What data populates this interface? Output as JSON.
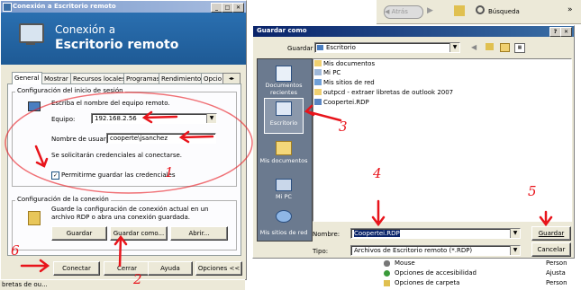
{
  "rdc": {
    "title": "Conexión a Escritorio remoto",
    "banner_line1": "Conexión a",
    "banner_line2": "Escritorio remoto",
    "tabs": [
      "General",
      "Mostrar",
      "Recursos locales",
      "Programas",
      "Rendimiento",
      "Opcio"
    ],
    "group_login": "Configuración del inicio de sesión",
    "prompt": "Escriba el nombre del equipo remoto.",
    "computer_label": "Equipo:",
    "computer_value": "192.168.2.56",
    "user_label": "Nombre de usuario:",
    "user_value": "cooperte\\jsanchez",
    "cred_note": "Se solicitarán credenciales al conectarse.",
    "save_cred_label": "Permitirme guardar las credenciales",
    "save_cred_checked": true,
    "group_conn": "Configuración de la conexión",
    "conn_text": "Guarde la configuración de conexión actual en un archivo RDP o abra una conexión guardada.",
    "btn_save": "Guardar",
    "btn_save_as": "Guardar como...",
    "btn_open": "Abrir...",
    "btn_connect": "Conectar",
    "btn_close": "Cerrar",
    "btn_help": "Ayuda",
    "btn_options": "Opciones <<"
  },
  "taskbar_left": "bretas de ou...",
  "explorer": {
    "back": "Atrás",
    "search": "Búsqueda",
    "chevron": "»",
    "list_items": [
      {
        "name": "Mouse",
        "value": "Person"
      },
      {
        "name": "Opciones de accesibilidad",
        "value": "Ajusta"
      },
      {
        "name": "Opciones de carpeta",
        "value": "Person"
      }
    ]
  },
  "saveas": {
    "title": "Guardar como",
    "save_in_label": "Guardar en:",
    "save_in_value": "Escritorio",
    "places": [
      "Documentos recientes",
      "Escritorio",
      "Mis documentos",
      "Mi PC",
      "Mis sitios de red"
    ],
    "files": [
      "Mis documentos",
      "Mi PC",
      "Mis sitios de red",
      "outpcd - extraer libretas de outlook 2007",
      "Coopertei.RDP"
    ],
    "name_label": "Nombre:",
    "name_value": "Coopertei.RDP",
    "type_label": "Tipo:",
    "type_value": "Archivos de Escritorio remoto (*.RDP)",
    "btn_save": "Guardar",
    "btn_cancel": "Cancelar",
    "help_btn": "?"
  },
  "annotations": [
    "1",
    "2",
    "3",
    "4",
    "5",
    "6"
  ],
  "colors": {
    "annotation": "#e8141b",
    "xp_title": "#0a246a",
    "rdc_banner": "#2a6fb0",
    "places_bar": "#6b7a8f"
  }
}
